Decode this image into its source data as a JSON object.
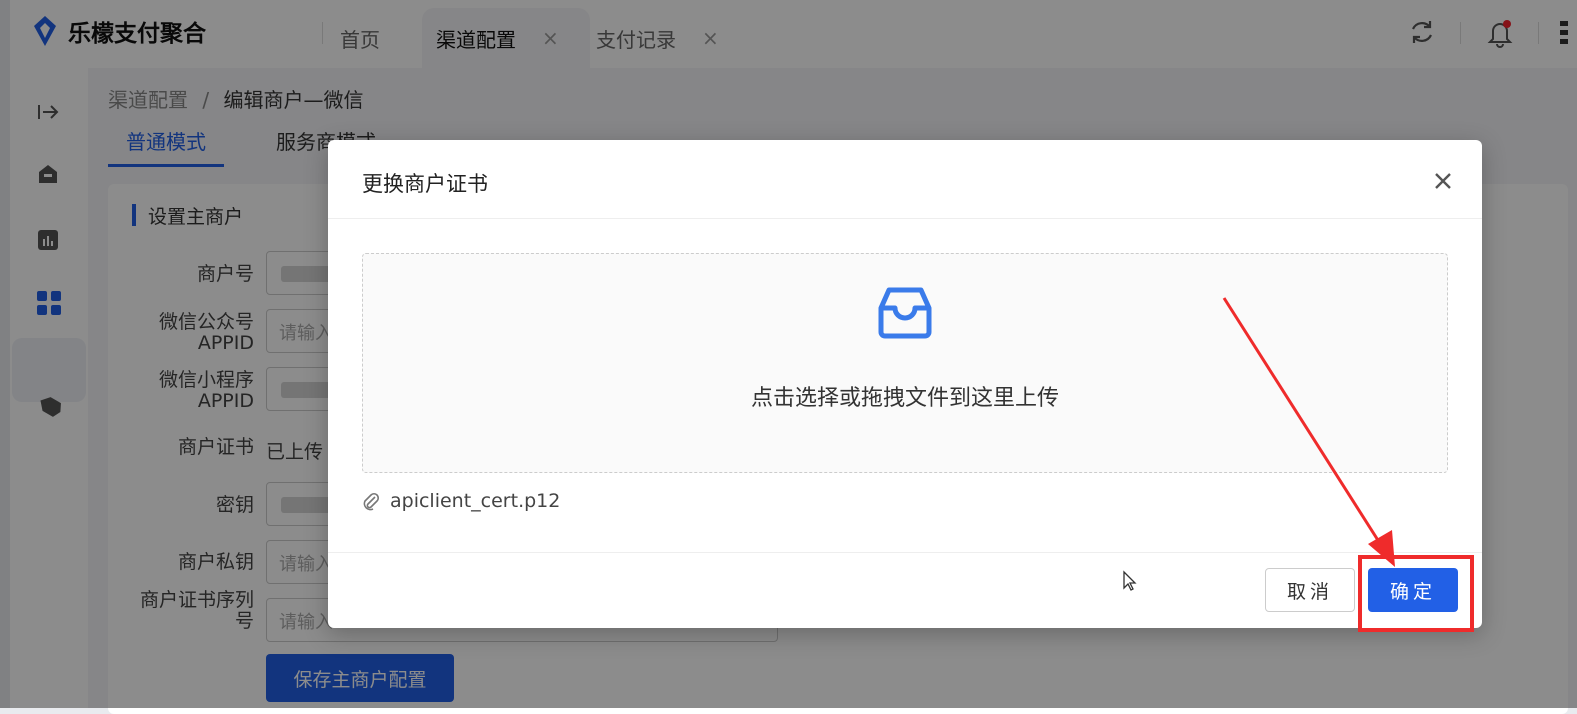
{
  "app": {
    "title": "乐檬支付聚合"
  },
  "tabs": [
    {
      "label": "首页",
      "closable": false
    },
    {
      "label": "渠道配置",
      "closable": true,
      "active": true
    },
    {
      "label": "支付记录",
      "closable": true
    }
  ],
  "tab_close_glyph": "×",
  "breadcrumb": {
    "root": "渠道配置",
    "sep": "/",
    "current": "编辑商户—微信"
  },
  "modes": [
    {
      "label": "普通模式",
      "active": true
    },
    {
      "label": "服务商模式",
      "active": false
    }
  ],
  "section": {
    "title": "设置主商户"
  },
  "form": {
    "merchant_no_label": "商户号",
    "mp_appid_label_1": "微信公众号",
    "mp_appid_label_2": "APPID",
    "mp_appid_placeholder": "请输入",
    "mini_appid_label_1": "微信小程序",
    "mini_appid_label_2": "APPID",
    "cert_label": "商户证书",
    "cert_value": "已上传",
    "key_label": "密钥",
    "private_key_label": "商户私钥",
    "private_key_placeholder": "请输入",
    "serial_label_1": "商户证书序列",
    "serial_label_2": "号",
    "serial_placeholder": "请输入",
    "save_label": "保存主商户配置"
  },
  "modal": {
    "title": "更换商户证书",
    "close_glyph": "×",
    "drop_text": "点击选择或拖拽文件到这里上传",
    "file_name": "apiclient_cert.p12",
    "cancel_label": "取消",
    "ok_label": "确定"
  },
  "colors": {
    "primary": "#2260e6",
    "annotation": "#ef2b2b"
  },
  "icons": [
    "logo-icon",
    "refresh-icon",
    "bell-icon",
    "menu-icon",
    "collapse-icon",
    "home-icon",
    "chart-icon",
    "grid-icon",
    "tag-icon",
    "inbox-icon",
    "paperclip-icon",
    "close-icon",
    "cursor-icon"
  ]
}
